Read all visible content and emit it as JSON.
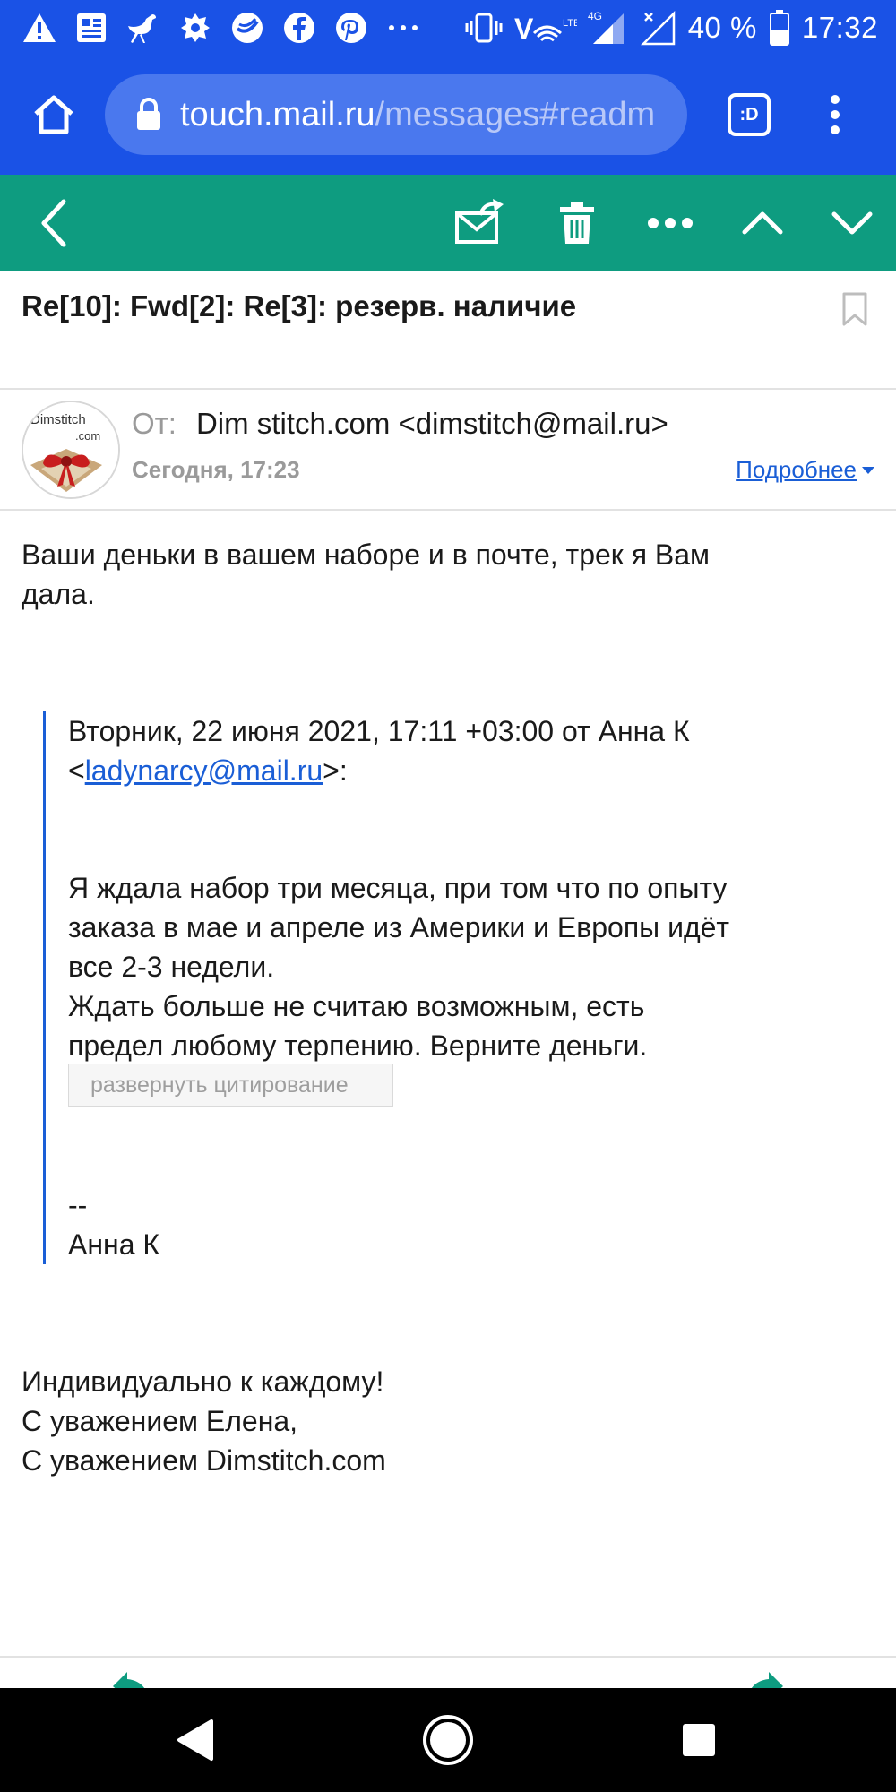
{
  "status_bar": {
    "network": "VoLTE 4G",
    "battery_percent": "40 %",
    "time": "17:32",
    "notification_icons": [
      "warning-icon",
      "news-icon",
      "ostrich-icon",
      "emblem-icon",
      "sber-icon",
      "facebook-icon",
      "pinterest-icon",
      "more-icon"
    ]
  },
  "browser": {
    "url_host": "touch.mail.ru",
    "url_path": "/messages#readm",
    "tabs_label": ":D"
  },
  "message": {
    "subject": "Re[10]: Fwd[2]: Re[3]: резерв. наличие",
    "from_label": "От:",
    "from_value": "Dim stitch.com <dimstitch@mail.ru>",
    "date": "Сегодня, 17:23",
    "details_label": "Подробнее",
    "avatar_text": "Dimstitch .com",
    "body_line1": "Ваши деньки в вашем наборе и в почте, трек я Вам",
    "body_line2": "дала.",
    "quote": {
      "header_line1": "Вторник, 22 июня 2021, 17:11 +03:00 от Анна К",
      "header_lt": "<",
      "header_email": "ladynarcy@mail.ru",
      "header_gt": ">:",
      "text_line1": "Я ждала набор три месяца, при том что по опыту",
      "text_line2": "заказа в мае и апреле из Америки и Европы идёт",
      "text_line3": "все 2-3 недели.",
      "text_line4": "Ждать больше не считаю возможным, есть",
      "text_line5": "предел любому терпению. Верните деньги.",
      "expand_label": "развернуть цитирование",
      "sig_dash": "--",
      "sig_name": "Анна К"
    },
    "signature_line1": "Индивидуально к каждому!",
    "signature_line2": "С уважением Елена,",
    "signature_line3": "С уважением Dimstitch.com"
  },
  "colors": {
    "browser_bar": "#1a52e6",
    "app_toolbar": "#0e9c80",
    "link": "#1a5ed6"
  }
}
